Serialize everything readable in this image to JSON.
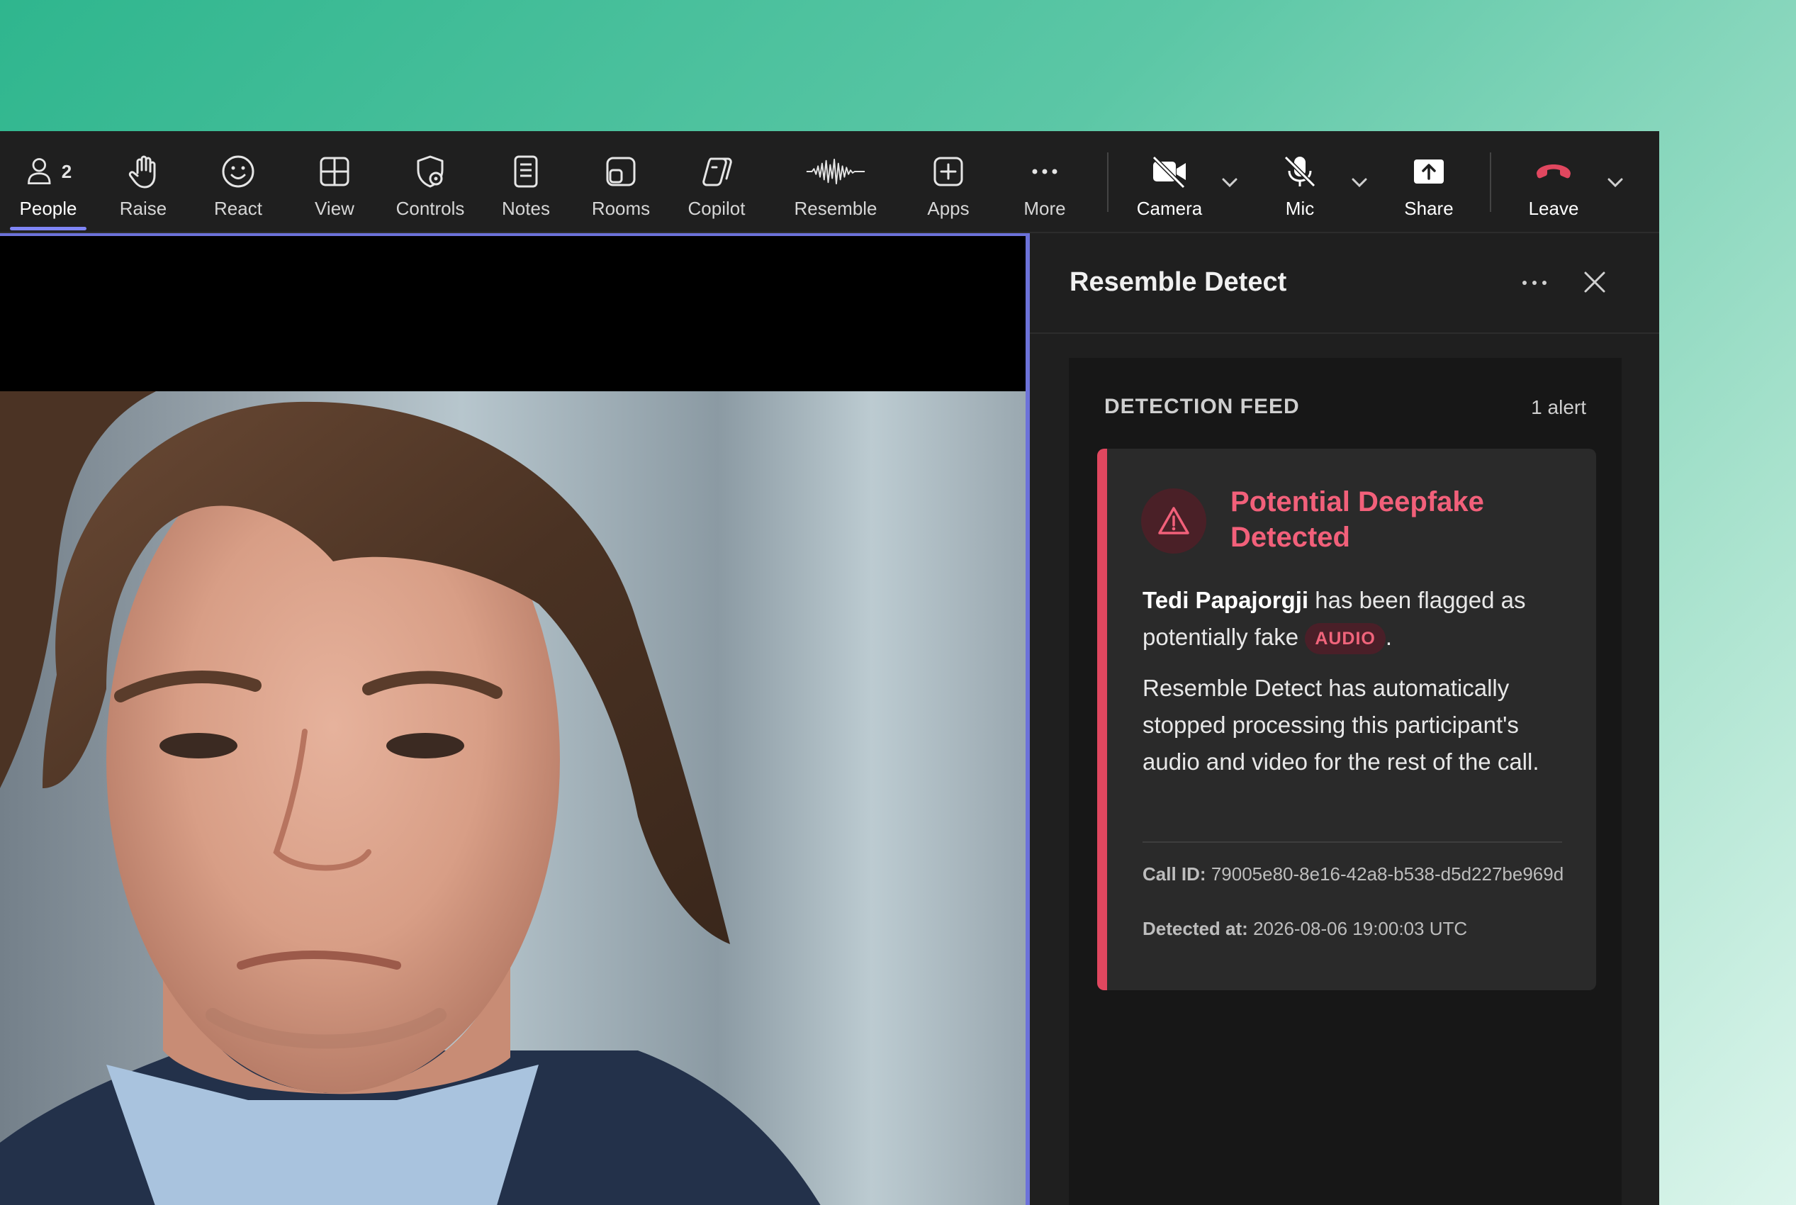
{
  "toolbar": {
    "people": {
      "label": "People",
      "count": "2",
      "icon": "people-icon"
    },
    "raise": {
      "label": "Raise",
      "icon": "raise-hand-icon"
    },
    "react": {
      "label": "React",
      "icon": "smiley-icon"
    },
    "view": {
      "label": "View",
      "icon": "grid-icon"
    },
    "controls": {
      "label": "Controls",
      "icon": "shield-gear-icon"
    },
    "notes": {
      "label": "Notes",
      "icon": "notes-icon"
    },
    "rooms": {
      "label": "Rooms",
      "icon": "rooms-icon"
    },
    "copilot": {
      "label": "Copilot",
      "icon": "copilot-icon"
    },
    "resemble": {
      "label": "Resemble",
      "icon": "waveform-icon"
    },
    "apps": {
      "label": "Apps",
      "icon": "plus-square-icon"
    },
    "more": {
      "label": "More",
      "icon": "ellipsis-icon"
    },
    "camera": {
      "label": "Camera",
      "icon": "camera-off-icon"
    },
    "mic": {
      "label": "Mic",
      "icon": "mic-off-icon"
    },
    "share": {
      "label": "Share",
      "icon": "share-icon"
    },
    "leave": {
      "label": "Leave",
      "icon": "phone-hangup-icon",
      "color": "#e0475f"
    }
  },
  "panel": {
    "title": "Resemble Detect",
    "feed": {
      "title": "DETECTION FEED",
      "count": "1 alert"
    },
    "alert": {
      "title": "Potential Deepfake Detected",
      "participant": "Tedi Papajorgji",
      "flag_text_1": " has been flagged as potentially fake ",
      "badge": "AUDIO",
      "flag_text_end": ".",
      "message": "Resemble Detect has automatically stopped processing this participant's audio and video for the rest of the call.",
      "call_id_label": "Call ID:",
      "call_id": "79005e80-8e16-42a8-b538-d5d227be969d",
      "detected_label": "Detected at:",
      "detected_at": "2026-08-06 19:00:03 UTC"
    }
  },
  "colors": {
    "accent": "#7f85f5",
    "alert": "#e0475f",
    "alert_text": "#f2607a"
  }
}
